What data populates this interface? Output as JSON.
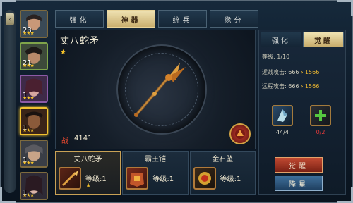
{
  "tabs": [
    "强化",
    "神器",
    "统兵",
    "缘分"
  ],
  "active_tab": "神器",
  "heroes": [
    {
      "level": "23",
      "stars": "★★★"
    },
    {
      "level": "21",
      "stars": "★★★"
    },
    {
      "level": "1",
      "stars": "★★★"
    },
    {
      "level": "1",
      "stars": "★★★"
    },
    {
      "level": "1",
      "stars": "★★★"
    },
    {
      "level": "1",
      "stars": "★★★"
    }
  ],
  "weapon": {
    "name": "丈八蛇矛",
    "star": "★",
    "power_icon": "战",
    "power": "4141"
  },
  "equipment": [
    {
      "name": "丈八蛇矛",
      "level": "等级:1",
      "star": "★"
    },
    {
      "name": "霸王铠",
      "level": "等级:1",
      "star": ""
    },
    {
      "name": "金石坠",
      "level": "等级:1",
      "star": ""
    }
  ],
  "right_tabs": [
    "强化",
    "觉醒"
  ],
  "right_active_tab": "觉醒",
  "stats": {
    "level": "等级: 1/10",
    "melee_label": "近战攻击:",
    "melee_from": "666",
    "melee_to": "1566",
    "ranged_label": "远程攻击:",
    "ranged_from": "666",
    "ranged_to": "1566"
  },
  "materials": [
    {
      "count": "44/4",
      "color": "#b8dde8"
    },
    {
      "count": "0/2",
      "color": "#e23a3a"
    }
  ],
  "buttons": {
    "awaken": "觉醒",
    "downgrade": "降星"
  },
  "side_knob": "‹"
}
